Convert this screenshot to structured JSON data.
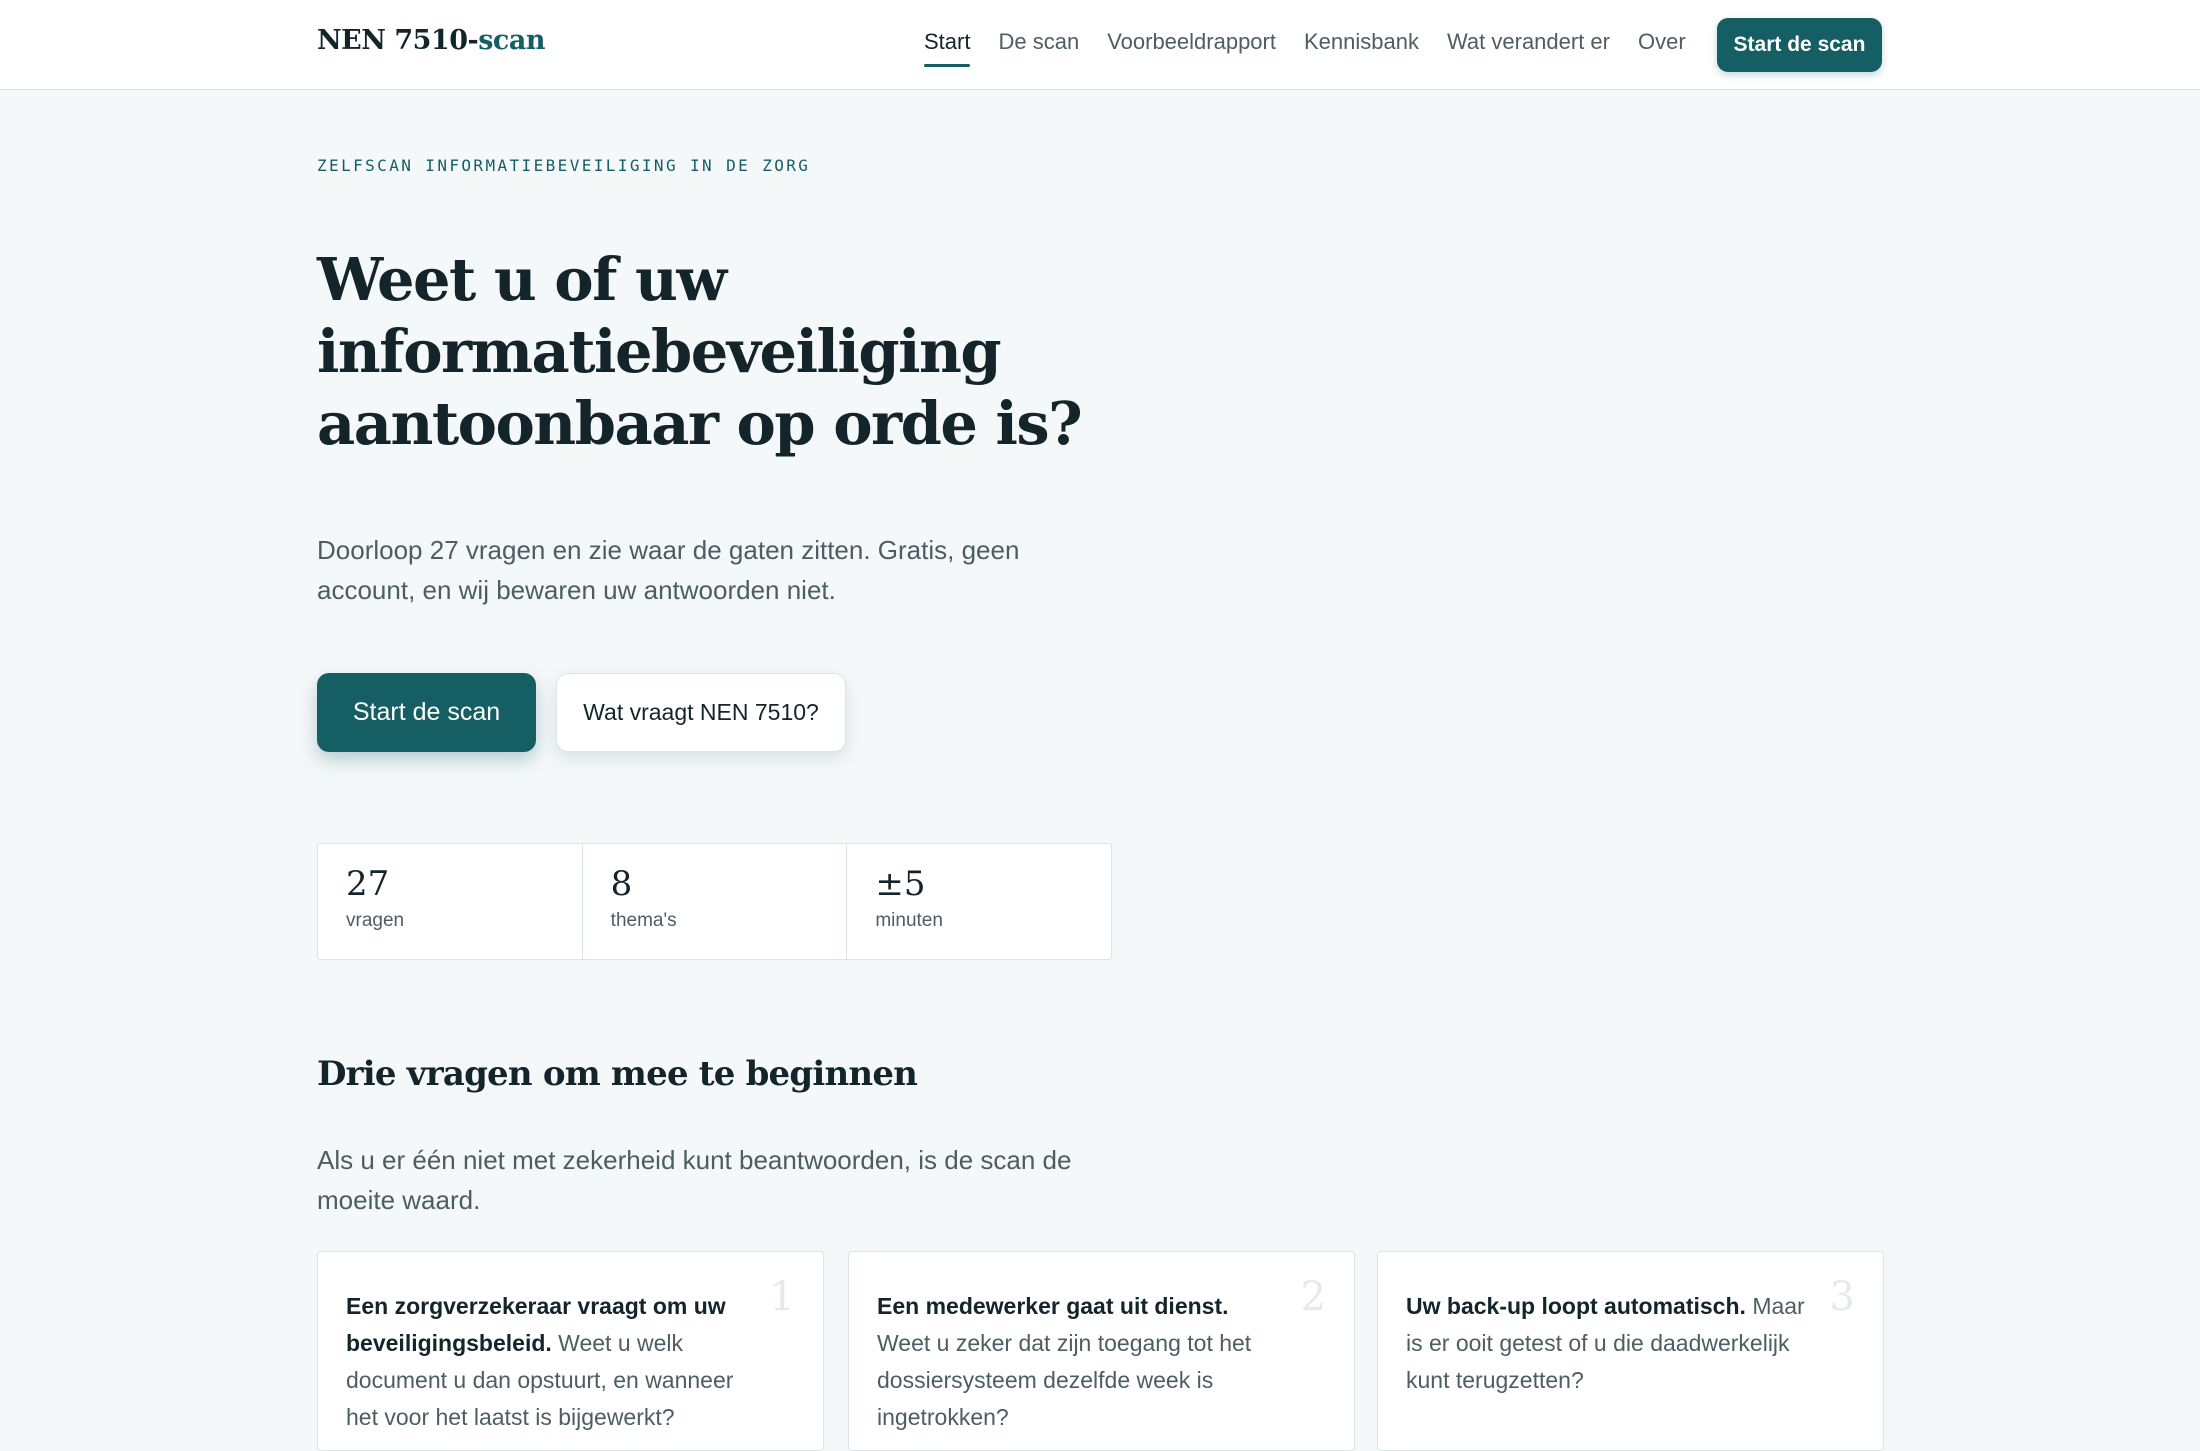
{
  "header": {
    "logo_main": "NEN 7510-",
    "logo_accent": "scan",
    "nav": [
      {
        "label": "Start",
        "active": true
      },
      {
        "label": "De scan",
        "active": false
      },
      {
        "label": "Voorbeeldrapport",
        "active": false
      },
      {
        "label": "Kennisbank",
        "active": false
      },
      {
        "label": "Wat verandert er",
        "active": false
      },
      {
        "label": "Over",
        "active": false
      }
    ],
    "cta_label": "Start de scan"
  },
  "hero": {
    "eyebrow": "ZELFSCAN INFORMATIEBEVEILIGING IN DE ZORG",
    "title": "Weet u of uw informatiebeveiliging aantoonbaar op orde is?",
    "lead": "Doorloop 27 vragen en zie waar de gaten zitten. Gratis, geen account, en wij bewaren uw antwoorden niet.",
    "primary_button": "Start de scan",
    "secondary_button": "Wat vraagt NEN 7510?"
  },
  "stats": [
    {
      "value": "27",
      "label": "vragen"
    },
    {
      "value": "8",
      "label": "thema's"
    },
    {
      "value": "±5",
      "label": "minuten"
    }
  ],
  "questions_section": {
    "title": "Drie vragen om mee te beginnen",
    "lead": "Als u er één niet met zekerheid kunt beantwoorden, is de scan de moeite waard.",
    "cards": [
      {
        "number": "1",
        "title": "Een zorgverzekeraar vraagt om uw beveiligingsbeleid.",
        "text": "Weet u welk document u dan opstuurt, en wanneer het voor het laatst is bijgewerkt?"
      },
      {
        "number": "2",
        "title": "Een medewerker gaat uit dienst.",
        "text": "Weet u zeker dat zijn toegang tot het dossiersysteem dezelfde week is ingetrokken?"
      },
      {
        "number": "3",
        "title": "Uw back-up loopt automatisch.",
        "text": "Maar is er ooit getest of u die daadwerkelijk kunt terugzetten?"
      }
    ]
  },
  "colors": {
    "accent": "#155e63",
    "background": "#f5f8f9",
    "text": "#13242b",
    "muted": "#4d5d64"
  }
}
